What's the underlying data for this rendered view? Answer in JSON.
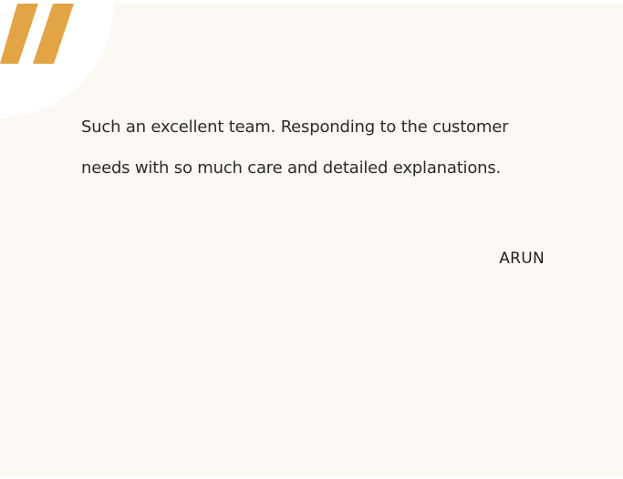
{
  "testimonial": {
    "quote": "Such an excellent team. Responding to the customer needs with so much care and detailed explanations.",
    "author": "ARUN",
    "icon": "quote-icon"
  },
  "colors": {
    "card_background": "#fcf8f3",
    "accent": "#e2a444",
    "text": "#2b2b2b"
  }
}
